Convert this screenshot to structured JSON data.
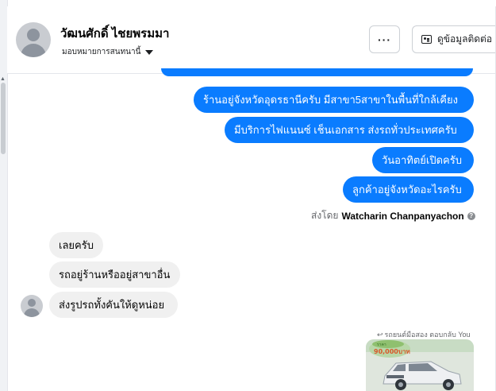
{
  "header": {
    "contact_name": "วัฒนศักดิ์ ไชยพรมมา",
    "assign_label": "มอบหมายการสนทนานี้",
    "more_label": "···",
    "contact_info_label": "ดูข้อมูลติดต่อ"
  },
  "messages": {
    "outgoing": [
      "ร้านอยู่จังหวัดอุดรธานีครับ มีสาขา5สาขาในพื้นที่ใกล้เคียง",
      "มีบริการไฟแนนซ์ เช็นเอกสาร ส่งรถทั่วประเทศครับ",
      "วันอาทิตย์เปิดครับ",
      "ลูกค้าอยู่จังหวัดอะไรครับ"
    ],
    "sent_by_prefix": "ส่งโดย",
    "sent_by_name": "Watcharin Chanpanyachon",
    "incoming": [
      "เลยครับ",
      "รถอยู่ร้านหรืออยู่สาขาอื่น",
      "ส่งรูปรถทั้งคันให้ดูหน่อย"
    ],
    "reply_note": "รถยนต์มือสอง ตอบกลับ You",
    "photo_price": "ราคา",
    "photo_amount": "90,000บาท"
  },
  "colors": {
    "outgoing_bubble": "#0a7cff",
    "incoming_bubble": "#f0f0f0"
  },
  "icons": {
    "more": "ellipsis-icon",
    "contact": "contact-card-icon",
    "info": "question-icon",
    "reply": "reply-arrow-icon"
  }
}
